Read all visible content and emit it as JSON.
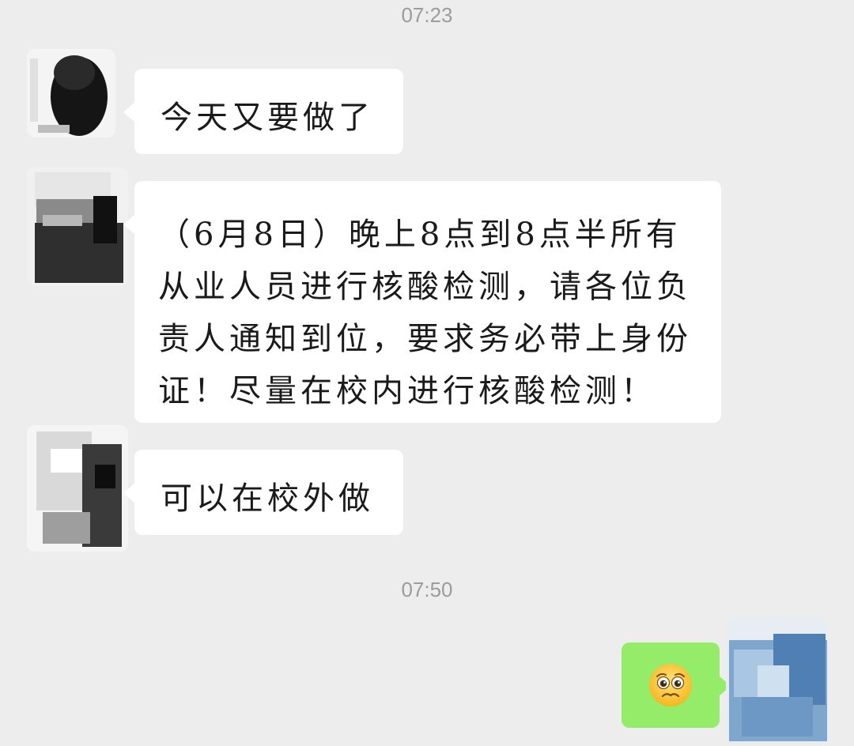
{
  "chat": {
    "groups": [
      {
        "time": "07:23"
      },
      {
        "time": "07:50"
      }
    ],
    "messages": [
      {
        "sender": "other",
        "text": "今天又要做了"
      },
      {
        "sender": "other",
        "text": "（6月8日）晚上8点到8点半所有\n从业人员进行核酸检测，请各位负\n责人通知到位，要求务必带上身份\n证！尽量在校内进行核酸检测！"
      },
      {
        "sender": "other",
        "text": "可以在校外做"
      },
      {
        "sender": "self",
        "emoji": "🥺",
        "emoji_name": "pleading-face-emoji"
      }
    ]
  },
  "colors": {
    "background": "#ededed",
    "incoming_bubble": "#ffffff",
    "outgoing_bubble": "#95ec69",
    "timestamp_text": "#9c9c9c"
  }
}
